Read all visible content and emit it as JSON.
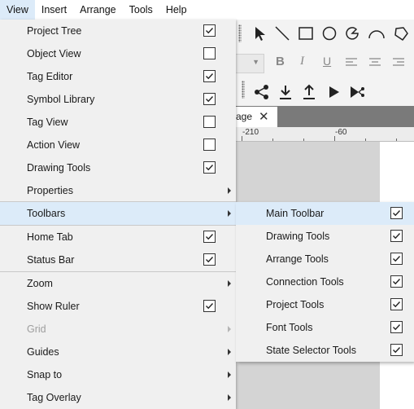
{
  "menubar": {
    "items": [
      {
        "label": "View",
        "active": true
      },
      {
        "label": "Insert",
        "active": false
      },
      {
        "label": "Arrange",
        "active": false
      },
      {
        "label": "Tools",
        "active": false
      },
      {
        "label": "Help",
        "active": false
      }
    ]
  },
  "view_menu": {
    "items": [
      {
        "label": "Project Tree",
        "checked": true
      },
      {
        "label": "Object View",
        "checked": false
      },
      {
        "label": "Tag Editor",
        "checked": true
      },
      {
        "label": "Symbol Library",
        "checked": true
      },
      {
        "label": "Tag View",
        "checked": false
      },
      {
        "label": "Action View",
        "checked": false
      },
      {
        "label": "Drawing Tools",
        "checked": true
      },
      {
        "label": "Properties",
        "submenu": true
      },
      {
        "label": "Toolbars",
        "submenu": true,
        "highlighted": true
      },
      {
        "label": "Home Tab",
        "checked": true
      },
      {
        "label": "Status Bar",
        "checked": true
      },
      {
        "label": "Zoom",
        "submenu": true
      },
      {
        "label": "Show Ruler",
        "checked": true
      },
      {
        "label": "Grid",
        "submenu": true,
        "disabled": true
      },
      {
        "label": "Guides",
        "submenu": true
      },
      {
        "label": "Snap to",
        "submenu": true
      },
      {
        "label": "Tag Overlay",
        "submenu": true
      }
    ]
  },
  "toolbars_submenu": {
    "items": [
      {
        "label": "Main Toolbar",
        "checked": true,
        "highlighted": true
      },
      {
        "label": "Drawing Tools",
        "checked": true
      },
      {
        "label": "Arrange Tools",
        "checked": true
      },
      {
        "label": "Connection Tools",
        "checked": true
      },
      {
        "label": "Project Tools",
        "checked": true
      },
      {
        "label": "Font Tools",
        "checked": true
      },
      {
        "label": "State Selector Tools",
        "checked": true
      }
    ]
  },
  "document": {
    "tab_label": "age",
    "close_glyph": "✕",
    "ruler_labels": [
      "-210",
      "-60"
    ]
  },
  "toolbar_icons": [
    "select-arrow-icon",
    "line-icon",
    "rectangle-icon",
    "ellipse-icon",
    "pie-icon",
    "arc-icon",
    "polygon-icon",
    "bold-icon",
    "italic-icon",
    "underline-icon",
    "align-left-icon",
    "align-center-icon",
    "align-right-icon",
    "share-icon",
    "download-icon",
    "upload-icon",
    "play-icon",
    "connection-icon"
  ],
  "font_styles": {
    "bold": "B",
    "italic": "I",
    "underline": "U"
  },
  "colors": {
    "highlight": "#dcebf9",
    "menu_bg": "#f0f0f0",
    "canvas": "#d4d4d4"
  }
}
